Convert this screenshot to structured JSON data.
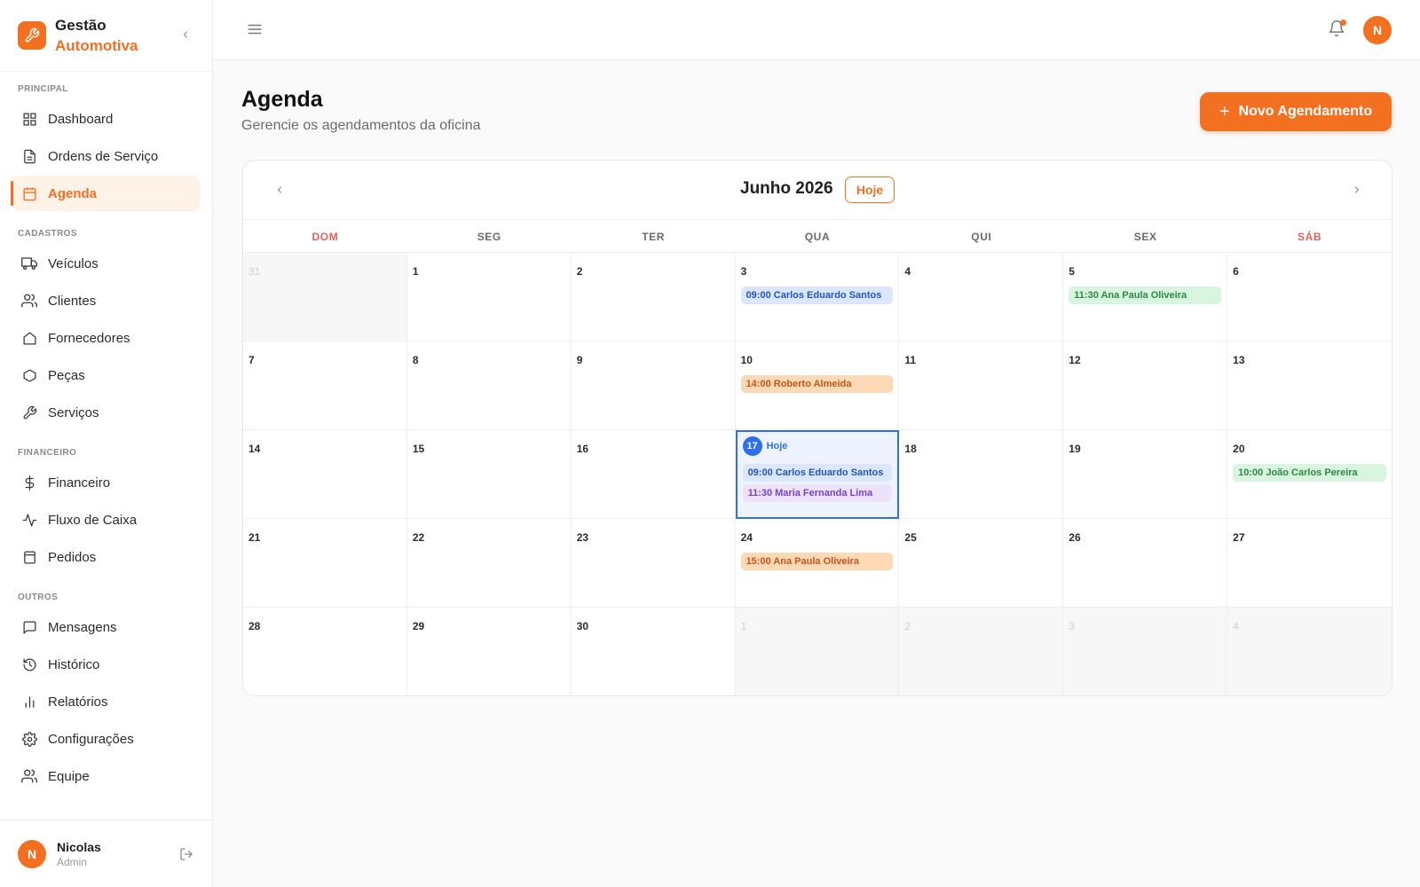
{
  "brand": {
    "line1": "Gestão",
    "line2": "Automotiva"
  },
  "colors": {
    "accent": "#f37021",
    "today": "#2f6fed"
  },
  "sidebar": {
    "sections": [
      {
        "label": "PRINCIPAL",
        "items": [
          {
            "label": "Dashboard",
            "icon": "grid-icon"
          },
          {
            "label": "Ordens de Serviço",
            "icon": "document-icon"
          },
          {
            "label": "Agenda",
            "icon": "calendar-icon",
            "active": true
          }
        ]
      },
      {
        "label": "CADASTROS",
        "items": [
          {
            "label": "Veículos",
            "icon": "truck-icon"
          },
          {
            "label": "Clientes",
            "icon": "users-icon"
          },
          {
            "label": "Fornecedores",
            "icon": "home-icon"
          },
          {
            "label": "Peças",
            "icon": "hexagon-icon"
          },
          {
            "label": "Serviços",
            "icon": "wrench-icon"
          }
        ]
      },
      {
        "label": "FINANCEIRO",
        "items": [
          {
            "label": "Financeiro",
            "icon": "dollar-icon"
          },
          {
            "label": "Fluxo de Caixa",
            "icon": "activity-icon"
          },
          {
            "label": "Pedidos",
            "icon": "box-icon"
          }
        ]
      },
      {
        "label": "OUTROS",
        "items": [
          {
            "label": "Mensagens",
            "icon": "message-icon"
          },
          {
            "label": "Histórico",
            "icon": "history-icon"
          },
          {
            "label": "Relatórios",
            "icon": "bar-chart-icon"
          },
          {
            "label": "Configurações",
            "icon": "gear-icon"
          },
          {
            "label": "Equipe",
            "icon": "users-icon"
          }
        ]
      }
    ]
  },
  "user": {
    "initial": "N",
    "name": "Nicolas",
    "role": "Admin"
  },
  "header": {
    "avatar_initial": "N"
  },
  "page": {
    "title": "Agenda",
    "subtitle": "Gerencie os agendamentos da oficina",
    "new_button": "Novo Agendamento",
    "new_button_icon": "+"
  },
  "calendar": {
    "month_label": "Junho 2026",
    "today_button": "Hoje",
    "weekdays": [
      "DOM",
      "SEG",
      "TER",
      "QUA",
      "QUI",
      "SEX",
      "SÁB"
    ],
    "today_label": "Hoje",
    "days": [
      {
        "day": "31",
        "outside": true,
        "events": []
      },
      {
        "day": "1",
        "events": []
      },
      {
        "day": "2",
        "events": []
      },
      {
        "day": "3",
        "events": [
          {
            "text": "09:00 Carlos Eduardo Santos",
            "color": "blue"
          }
        ]
      },
      {
        "day": "4",
        "events": []
      },
      {
        "day": "5",
        "events": [
          {
            "text": "11:30 Ana Paula Oliveira",
            "color": "green"
          }
        ]
      },
      {
        "day": "6",
        "events": []
      },
      {
        "day": "7",
        "events": []
      },
      {
        "day": "8",
        "events": []
      },
      {
        "day": "9",
        "events": []
      },
      {
        "day": "10",
        "events": [
          {
            "text": "14:00 Roberto Almeida",
            "color": "orange"
          }
        ]
      },
      {
        "day": "11",
        "events": []
      },
      {
        "day": "12",
        "events": []
      },
      {
        "day": "13",
        "events": []
      },
      {
        "day": "14",
        "events": []
      },
      {
        "day": "15",
        "events": []
      },
      {
        "day": "16",
        "events": []
      },
      {
        "day": "17",
        "today": true,
        "events": [
          {
            "text": "09:00 Carlos Eduardo Santos",
            "color": "blue"
          },
          {
            "text": "11:30 Maria Fernanda Lima",
            "color": "purple"
          }
        ]
      },
      {
        "day": "18",
        "events": []
      },
      {
        "day": "19",
        "events": []
      },
      {
        "day": "20",
        "events": [
          {
            "text": "10:00 João Carlos Pereira",
            "color": "green"
          }
        ]
      },
      {
        "day": "21",
        "events": []
      },
      {
        "day": "22",
        "events": []
      },
      {
        "day": "23",
        "events": []
      },
      {
        "day": "24",
        "events": [
          {
            "text": "15:00 Ana Paula Oliveira",
            "color": "orange"
          }
        ]
      },
      {
        "day": "25",
        "events": []
      },
      {
        "day": "26",
        "events": []
      },
      {
        "day": "27",
        "events": []
      },
      {
        "day": "28",
        "events": []
      },
      {
        "day": "29",
        "events": []
      },
      {
        "day": "30",
        "events": []
      },
      {
        "day": "1",
        "outside": true,
        "events": []
      },
      {
        "day": "2",
        "outside": true,
        "events": []
      },
      {
        "day": "3",
        "outside": true,
        "events": []
      },
      {
        "day": "4",
        "outside": true,
        "events": []
      }
    ]
  }
}
